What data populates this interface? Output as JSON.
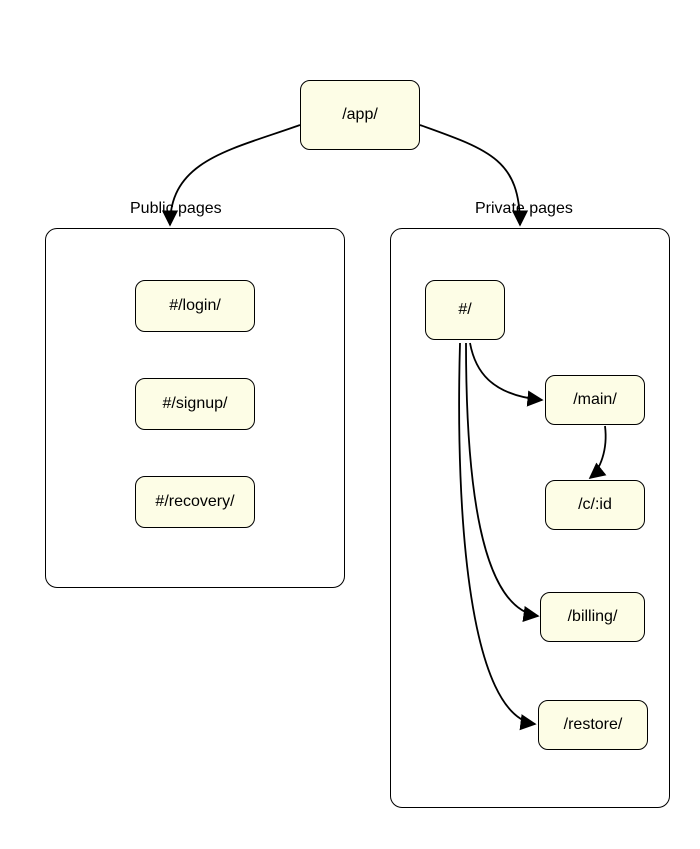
{
  "root": {
    "label": "/app/"
  },
  "public": {
    "title": "Public pages",
    "items": [
      {
        "label": "#/login/"
      },
      {
        "label": "#/signup/"
      },
      {
        "label": "#/recovery/"
      }
    ]
  },
  "private": {
    "title": "Private pages",
    "root": {
      "label": "#/"
    },
    "main": {
      "label": "/main/"
    },
    "cid": {
      "label": "/c/:id"
    },
    "billing": {
      "label": "/billing/"
    },
    "restore": {
      "label": "/restore/"
    }
  }
}
